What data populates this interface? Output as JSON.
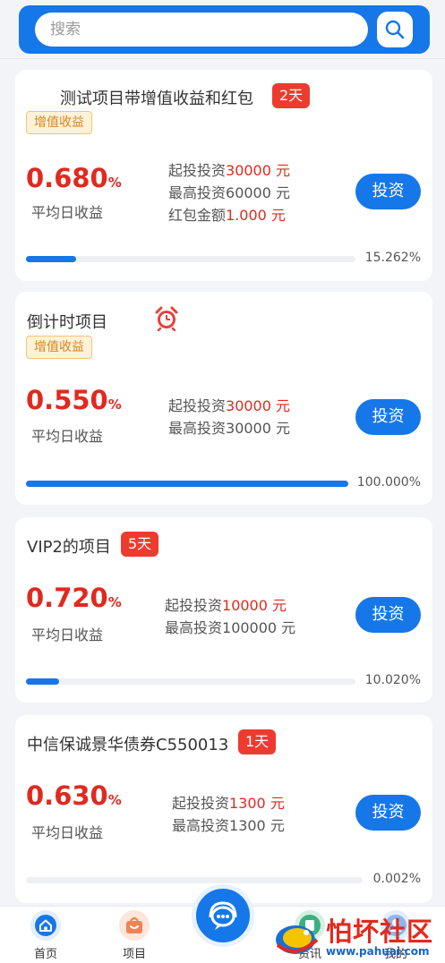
{
  "search": {
    "placeholder": "搜索"
  },
  "projects": [
    {
      "title": "测试项目带增值收益和红包",
      "days": "2天",
      "tag": "增值收益",
      "rate": "0.680",
      "rate_unit": "%",
      "rate_label": "平均日收益",
      "min_invest_label": "起投投资",
      "min_invest_value": "30000 元",
      "max_invest_label": "最高投资",
      "max_invest_value": "60000 元",
      "redpacket_label": "红包金额",
      "redpacket_value": "1.000 元",
      "button": "投资",
      "progress": 15.262,
      "progress_text": "15.262%"
    },
    {
      "title": "倒计时项目",
      "tag": "增值收益",
      "rate": "0.550",
      "rate_unit": "%",
      "rate_label": "平均日收益",
      "min_invest_label": "起投投资",
      "min_invest_value": "30000 元",
      "max_invest_label": "最高投资",
      "max_invest_value": "30000 元",
      "button": "投资",
      "progress": 100,
      "progress_text": "100.000%"
    },
    {
      "title": "VIP2的项目",
      "days": "5天",
      "rate": "0.720",
      "rate_unit": "%",
      "rate_label": "平均日收益",
      "min_invest_label": "起投投资",
      "min_invest_value": "10000 元",
      "max_invest_label": "最高投资",
      "max_invest_value": "100000 元",
      "button": "投资",
      "progress": 10.02,
      "progress_text": "10.020%"
    },
    {
      "title": "中信保诚景华债券C550013",
      "days": "1天",
      "rate": "0.630",
      "rate_unit": "%",
      "rate_label": "平均日收益",
      "min_invest_label": "起投投资",
      "min_invest_value": "1300 元",
      "max_invest_label": "最高投资",
      "max_invest_value": "1300 元",
      "button": "投资",
      "progress": 0.002,
      "progress_text": "0.002%"
    }
  ],
  "nav": {
    "home": "首页",
    "project": "项目",
    "news": "资讯",
    "mine": "我的"
  },
  "watermark": {
    "text": "怕坏社区",
    "url": "www.pahuai.com"
  },
  "colors": {
    "accent": "#1677e8",
    "red": "#e02a1f",
    "tag": "#d9851f"
  },
  "icons": [
    "search-icon",
    "alarm-clock-icon",
    "home-icon",
    "bag-icon",
    "customer-service-icon"
  ]
}
